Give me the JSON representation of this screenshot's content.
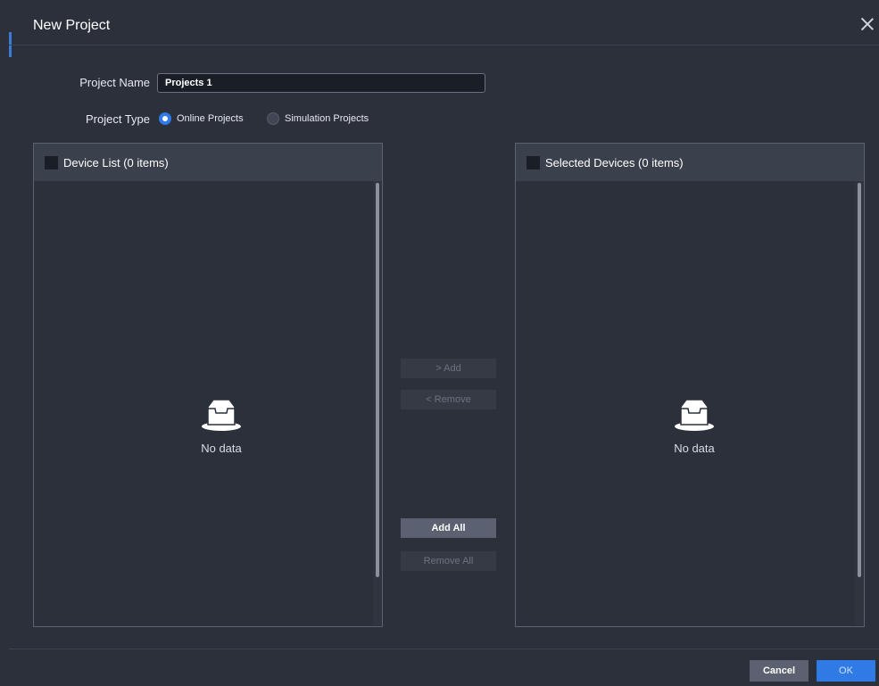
{
  "dialog": {
    "title": "New Project",
    "close_icon": "close-icon"
  },
  "form": {
    "name_label": "Project Name",
    "name_value": "Projects 1",
    "type_label": "Project Type",
    "type_options": [
      {
        "label": "Online Projects",
        "selected": true
      },
      {
        "label": "Simulation Projects",
        "selected": false
      }
    ]
  },
  "device_list": {
    "header": "Device List  (0 items)",
    "empty_text": "No data",
    "empty_icon": "inbox-icon"
  },
  "selected_devices": {
    "header": "Selected Devices  (0 items)",
    "empty_text": "No data",
    "empty_icon": "inbox-icon"
  },
  "transfer": {
    "add": "> Add",
    "remove": "< Remove",
    "add_all": "Add All",
    "remove_all": "Remove All"
  },
  "footer": {
    "cancel": "Cancel",
    "ok": "OK"
  },
  "colors": {
    "background": "#2b303b",
    "accent": "#2f7ae5",
    "panel_header": "#3a404c"
  }
}
